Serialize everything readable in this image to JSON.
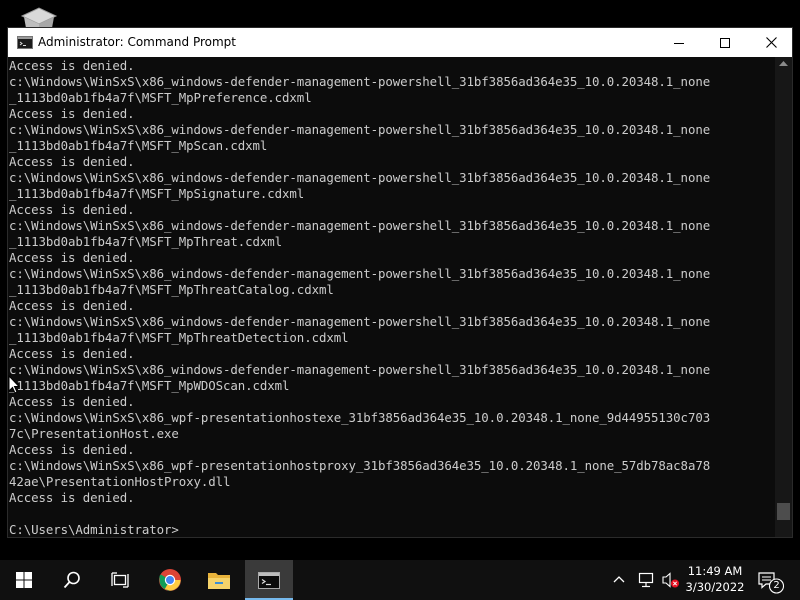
{
  "window": {
    "title": "Administrator: Command Prompt"
  },
  "console": {
    "lines": [
      "Access is denied.",
      "c:\\Windows\\WinSxS\\x86_windows-defender-management-powershell_31bf3856ad364e35_10.0.20348.1_none",
      "_1113bd0ab1fb4a7f\\MSFT_MpPreference.cdxml",
      "Access is denied.",
      "c:\\Windows\\WinSxS\\x86_windows-defender-management-powershell_31bf3856ad364e35_10.0.20348.1_none",
      "_1113bd0ab1fb4a7f\\MSFT_MpScan.cdxml",
      "Access is denied.",
      "c:\\Windows\\WinSxS\\x86_windows-defender-management-powershell_31bf3856ad364e35_10.0.20348.1_none",
      "_1113bd0ab1fb4a7f\\MSFT_MpSignature.cdxml",
      "Access is denied.",
      "c:\\Windows\\WinSxS\\x86_windows-defender-management-powershell_31bf3856ad364e35_10.0.20348.1_none",
      "_1113bd0ab1fb4a7f\\MSFT_MpThreat.cdxml",
      "Access is denied.",
      "c:\\Windows\\WinSxS\\x86_windows-defender-management-powershell_31bf3856ad364e35_10.0.20348.1_none",
      "_1113bd0ab1fb4a7f\\MSFT_MpThreatCatalog.cdxml",
      "Access is denied.",
      "c:\\Windows\\WinSxS\\x86_windows-defender-management-powershell_31bf3856ad364e35_10.0.20348.1_none",
      "_1113bd0ab1fb4a7f\\MSFT_MpThreatDetection.cdxml",
      "Access is denied.",
      "c:\\Windows\\WinSxS\\x86_windows-defender-management-powershell_31bf3856ad364e35_10.0.20348.1_none",
      "_1113bd0ab1fb4a7f\\MSFT_MpWDOScan.cdxml",
      "Access is denied.",
      "c:\\Windows\\WinSxS\\x86_wpf-presentationhostexe_31bf3856ad364e35_10.0.20348.1_none_9d44955130c703",
      "7c\\PresentationHost.exe",
      "Access is denied.",
      "c:\\Windows\\WinSxS\\x86_wpf-presentationhostproxy_31bf3856ad364e35_10.0.20348.1_none_57db78ac8a78",
      "42ae\\PresentationHostProxy.dll",
      "Access is denied.",
      "",
      "C:\\Users\\Administrator>"
    ]
  },
  "scrollbar": {
    "position": 0.97
  },
  "taskbar": {
    "items": [
      "start-icon",
      "search-icon",
      "task-view-icon",
      "chrome-icon",
      "file-explorer-icon",
      "command-prompt-icon"
    ],
    "active_item": "command-prompt-icon",
    "accent_color": "#76b9ed"
  },
  "tray": {
    "time": "11:49 AM",
    "date": "3/30/2022",
    "notification_count": "2"
  }
}
